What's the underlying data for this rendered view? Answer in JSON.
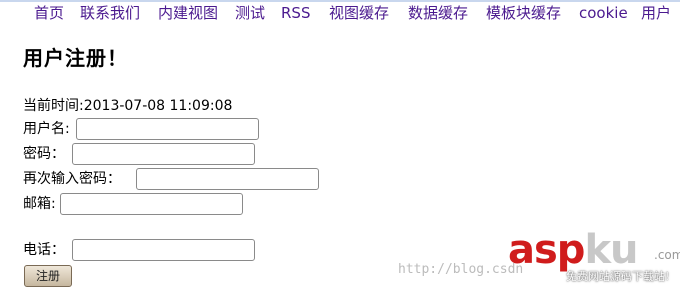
{
  "nav": {
    "items": [
      "首页",
      "联系我们",
      "内建视图",
      "测试",
      "RSS",
      "视图缓存",
      "数据缓存",
      "模板块缓存",
      "cookie",
      "用户"
    ]
  },
  "heading": "用户注册！",
  "current_time": "当前时间:2013-07-08 11:09:08",
  "form": {
    "username_label": "用户名:",
    "username_value": "",
    "password_label": "密码：",
    "password_value": "",
    "confirm_label": "再次输入密码：",
    "confirm_value": "",
    "email_label": "邮箱:",
    "email_value": "",
    "phone_label": "电话：",
    "phone_value": "",
    "submit_label": "注册"
  },
  "watermark": {
    "blog_text": "http://blog.csdn",
    "logo_asp": "asp",
    "logo_ku": "ku",
    "logo_com": ".com",
    "tagline": "免费网站源码下载站!"
  }
}
